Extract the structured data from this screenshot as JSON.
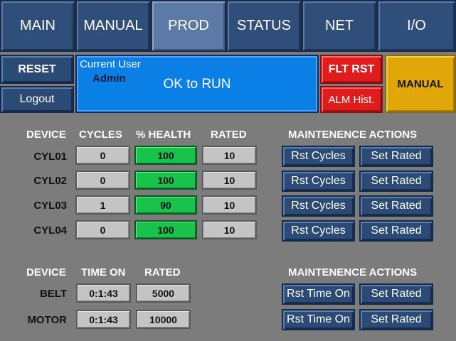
{
  "nav": {
    "tabs": [
      {
        "label": "MAIN",
        "active": false
      },
      {
        "label": "MANUAL",
        "active": false
      },
      {
        "label": "PROD",
        "active": true
      },
      {
        "label": "STATUS",
        "active": false
      },
      {
        "label": "NET",
        "active": false
      },
      {
        "label": "I/O",
        "active": false
      }
    ]
  },
  "controls": {
    "reset_label": "RESET",
    "logout_label": "Logout",
    "flt_rst_label": "FLT RST",
    "alm_hist_label": "ALM Hist.",
    "manual_label": "MANUAL"
  },
  "status": {
    "current_user_label": "Current User",
    "user_name": "Admin",
    "message": "OK to RUN"
  },
  "cylinders": {
    "headers": {
      "device": "DEVICE",
      "cycles": "CYCLES",
      "health": "% HEALTH",
      "rated": "RATED"
    },
    "maint_header": "MAINTENENCE ACTIONS",
    "rows": [
      {
        "device": "CYL01",
        "cycles": "0",
        "health": "100",
        "rated": "10",
        "rst_label": "Rst Cycles",
        "set_label": "Set Rated"
      },
      {
        "device": "CYL02",
        "cycles": "0",
        "health": "100",
        "rated": "10",
        "rst_label": "Rst Cycles",
        "set_label": "Set Rated"
      },
      {
        "device": "CYL03",
        "cycles": "1",
        "health": "90",
        "rated": "10",
        "rst_label": "Rst Cycles",
        "set_label": "Set Rated"
      },
      {
        "device": "CYL04",
        "cycles": "0",
        "health": "100",
        "rated": "10",
        "rst_label": "Rst Cycles",
        "set_label": "Set Rated"
      }
    ]
  },
  "motors": {
    "headers": {
      "device": "DEVICE",
      "time_on": "TIME ON",
      "rated": "RATED"
    },
    "maint_header": "MAINTENENCE ACTIONS",
    "rows": [
      {
        "device": "BELT",
        "time_on": "0:1:43",
        "rated": "5000",
        "rst_label": "Rst Time On",
        "set_label": "Set Rated"
      },
      {
        "device": "MOTOR",
        "time_on": "0:1:43",
        "rated": "10000",
        "rst_label": "Rst Time On",
        "set_label": "Set Rated"
      }
    ]
  },
  "colors": {
    "background": "#7c7c7c",
    "tab_blue": "#2f4e7a",
    "tab_active": "#5d7aa6",
    "status_blue": "#0a7fe6",
    "fault_red": "#e01c1c",
    "manual_yellow": "#e1a608",
    "health_green": "#19c24a"
  }
}
